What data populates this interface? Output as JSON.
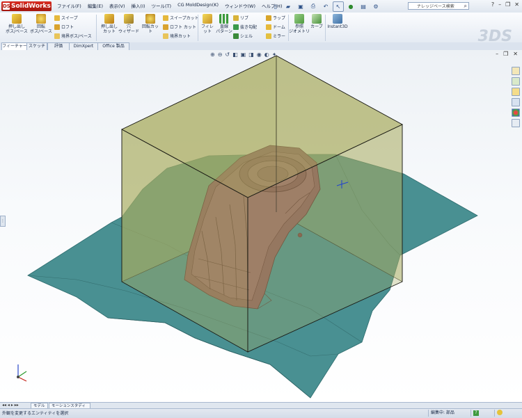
{
  "app": {
    "brand": "SolidWorks"
  },
  "menu": [
    "ファイル(F)",
    "編集(E)",
    "表示(V)",
    "挿入(I)",
    "ツール(T)",
    "CG MoldDesign(K)",
    "ウィンドウ(W)",
    "ヘルプ(H)"
  ],
  "search": {
    "placeholder": "ナレッジベース検索"
  },
  "ribbon": {
    "extrude_boss": "押し出し\nボス/ベース",
    "revolve_boss": "回転\nボス/ベース",
    "sweep": "スイープ",
    "loft": "ロフト",
    "boundary_boss": "境界ボス/ベース",
    "extrude_cut": "押し出し\nカット",
    "hole_wizard": "穴\nウィザード",
    "revolve_cut": "回転カット",
    "sweep_cut": "スイープカット",
    "loft_cut": "ロフト カット",
    "boundary_cut": "境界カット",
    "fillet": "フィレット",
    "linear_pattern": "直線\nパターン",
    "rib": "リブ",
    "draft": "抜き勾配",
    "shell": "シェル",
    "wrap": "ラップ",
    "dome": "ドーム",
    "mirror": "ミラー",
    "ref_geometry": "参照\nジオメトリ",
    "curves": "カーブ",
    "instant3d": "Instant3D"
  },
  "tabs": [
    "フィーチャー",
    "スケッチ",
    "評価",
    "DimXpert",
    "Office 製品"
  ],
  "bottom_tabs": [
    "モデル",
    "モーションスタディ 1"
  ],
  "status": {
    "message": "外観を変更するエンティティを選択",
    "mode": "編集中: 部品",
    "icon_label": "?"
  },
  "colors": {
    "box_fill": "#a9ac5f",
    "base_plate": "#3f8a8c",
    "part": "#8d5f60",
    "accent_red": "#c4231a"
  }
}
